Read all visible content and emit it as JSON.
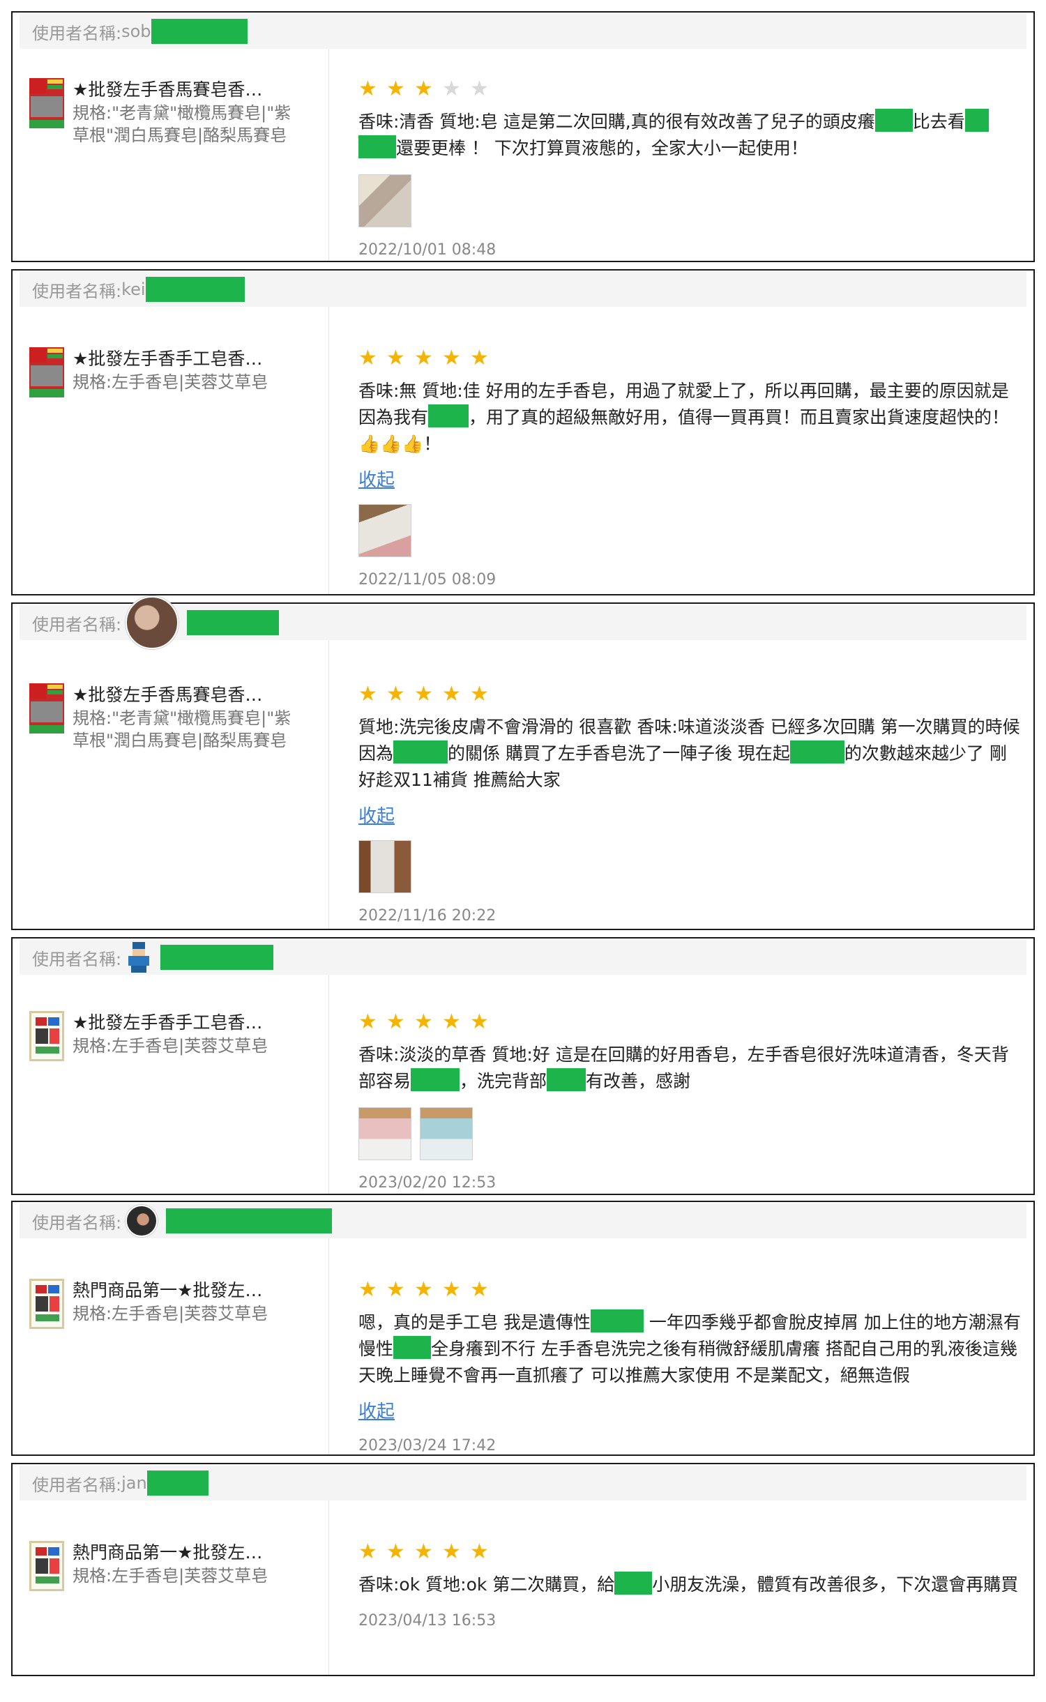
{
  "user_label": "使用者名稱:",
  "collapse_label": "收起",
  "reviews": [
    {
      "username": "sob",
      "rating": 3,
      "product_title": "★批發左手香馬賽皂香…",
      "product_spec": "規格:\"老青黛\"橄欖馬賽皂|\"紫草根\"潤白馬賽皂|酪梨馬賽皂",
      "comment_parts": [
        "香味:清香 質地:皂 這是第二次回購,真的很有效改善了兒子的頭皮癢",
        "比去看",
        "還要更棒 ！ 下次打算買液態的，全家大小一起使用！"
      ],
      "photo_count": 1,
      "timestamp": "2022/10/01 08:48"
    },
    {
      "username": "kei",
      "rating": 5,
      "product_title": "★批發左手香手工皂香…",
      "product_spec": "規格:左手香皂|芙蓉艾草皂",
      "comment_parts": [
        "香味:無 質地:佳 好用的左手香皂，用過了就愛上了，所以再回購，最主要的原因就是因為我有",
        "，用了真的超級無敵好用，值得一買再買！而且賣家出貨速度超快的！👍👍👍！"
      ],
      "photo_count": 1,
      "timestamp": "2022/11/05 08:09"
    },
    {
      "username": "",
      "rating": 5,
      "product_title": "★批發左手香馬賽皂香…",
      "product_spec": "規格:\"老青黛\"橄欖馬賽皂|\"紫草根\"潤白馬賽皂|酪梨馬賽皂",
      "comment_parts": [
        "質地:洗完後皮膚不會滑滑的 很喜歡 香味:味道淡淡香 已經多次回購 第一次購買的時候因為",
        "的關係 購買了左手香皂洗了一陣子後 現在起",
        "的次數越來越少了 剛好趁双11補貨 推薦給大家"
      ],
      "photo_count": 1,
      "timestamp": "2022/11/16 20:22"
    },
    {
      "username": "",
      "rating": 5,
      "product_title": "★批發左手香手工皂香…",
      "product_spec": "規格:左手香皂|芙蓉艾草皂",
      "comment_parts": [
        "香味:淡淡的草香 質地:好 這是在回購的好用香皂，左手香皂很好洗味道清香，冬天背部容易",
        "，洗完背部",
        "有改善，感謝"
      ],
      "photo_count": 2,
      "timestamp": "2023/02/20 12:53"
    },
    {
      "username": "",
      "rating": 5,
      "product_title": "熱門商品第一★批發左…",
      "product_spec": "規格:左手香皂|芙蓉艾草皂",
      "comment_parts": [
        "嗯，真的是手工皂 我是遺傳性",
        " 一年四季幾乎都會脫皮掉屑 加上住的地方潮濕有慢性",
        "全身癢到不行 左手香皂洗完之後有稍微舒緩肌膚癢 搭配自己用的乳液後這幾天晚上睡覺不會再一直抓癢了 可以推薦大家使用 不是業配文，絕無造假"
      ],
      "photo_count": 0,
      "timestamp": "2023/03/24 17:42"
    },
    {
      "username": "jan",
      "rating": 5,
      "product_title": "熱門商品第一★批發左…",
      "product_spec": "規格:左手香皂|芙蓉艾草皂",
      "comment_parts": [
        "香味:ok 質地:ok 第二次購買，給",
        "小朋友洗澡，體質有改善很多，下次還會再購買"
      ],
      "photo_count": 0,
      "timestamp": "2023/04/13 16:53"
    }
  ]
}
